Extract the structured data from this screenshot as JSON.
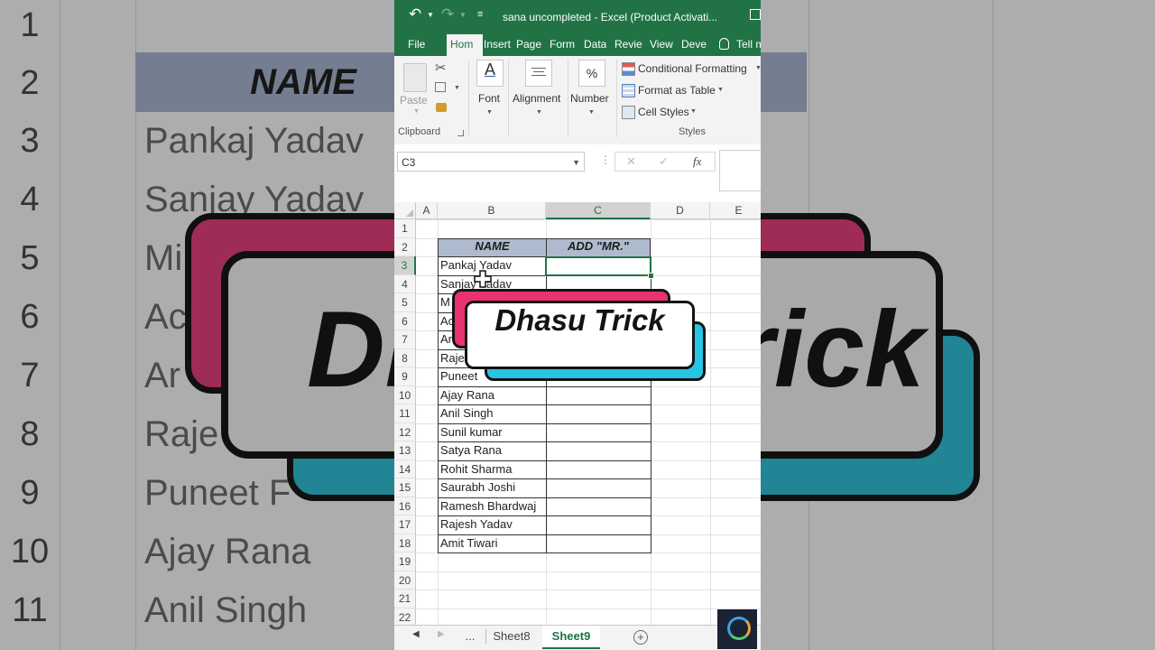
{
  "window": {
    "title": "sana uncompleted - Excel (Product Activati...",
    "qat_label": "≡"
  },
  "ribbon_tabs": [
    {
      "label": "File",
      "active": false
    },
    {
      "label": "Hom",
      "active": true
    },
    {
      "label": "Insert",
      "active": false
    },
    {
      "label": "Page",
      "active": false
    },
    {
      "label": "Form",
      "active": false
    },
    {
      "label": "Data",
      "active": false
    },
    {
      "label": "Revie",
      "active": false
    },
    {
      "label": "View",
      "active": false
    },
    {
      "label": "Deve",
      "active": false
    },
    {
      "label": "Tell m",
      "active": false
    }
  ],
  "ribbon": {
    "paste_label": "Paste",
    "clipboard_label": "Clipboard",
    "font_label": "Font",
    "font_icon": "A",
    "alignment_label": "Alignment",
    "number_label": "Number",
    "number_icon": "%",
    "conditional_formatting": "Conditional Formatting",
    "format_as_table": "Format as Table",
    "cell_styles": "Cell Styles",
    "styles_label": "Styles"
  },
  "formula_bar": {
    "name_box": "C3",
    "fx_label": "fx",
    "cancel_icon": "✕",
    "enter_icon": "✓",
    "value": ""
  },
  "grid": {
    "columns": [
      "A",
      "B",
      "C",
      "D",
      "E"
    ],
    "selected_column": "C",
    "rows": [
      "1",
      "2",
      "3",
      "4",
      "5",
      "6",
      "7",
      "8",
      "9",
      "10",
      "11",
      "12",
      "13",
      "14",
      "15",
      "16",
      "17",
      "18",
      "19",
      "20",
      "21",
      "22"
    ],
    "selected_row": "3",
    "header_name": "NAME",
    "header_add": "ADD \"MR.\"",
    "names": [
      "Pankaj Yadav",
      "Sanjay Yadav",
      "M",
      "Ac",
      "Ar",
      "Rajes",
      "Puneet",
      "Ajay Rana",
      "Anil Singh",
      "Sunil kumar",
      "Satya Rana",
      "Rohit Sharma",
      "Saurabh Joshi",
      "Ramesh Bhardwaj",
      "Rajesh Yadav",
      "Amit Tiwari"
    ]
  },
  "sheet_tabs": {
    "ellipsis": "...",
    "tabs": [
      {
        "label": "Sheet8",
        "active": false
      },
      {
        "label": "Sheet9",
        "active": true
      }
    ],
    "add_label": "+"
  },
  "overlay": {
    "badge_text": "Dhasu Trick",
    "colors": {
      "pink": "#e8336e",
      "cyan": "#27c4e3",
      "excel_green": "#217346",
      "header_fill": "#aebace"
    }
  },
  "background": {
    "row_numbers": [
      "1",
      "2",
      "3",
      "4",
      "5",
      "6",
      "7",
      "8",
      "9",
      "10",
      "11"
    ],
    "header_name": "NAME",
    "names": [
      "",
      "",
      "Pankaj Yadav",
      "Sanjay Yadav",
      "Mi",
      "Ac",
      "Ar",
      "Raje",
      "Puneet F",
      "Ajay Rana",
      "Anil Singh"
    ],
    "badge_text": "Dhasu Trick"
  }
}
